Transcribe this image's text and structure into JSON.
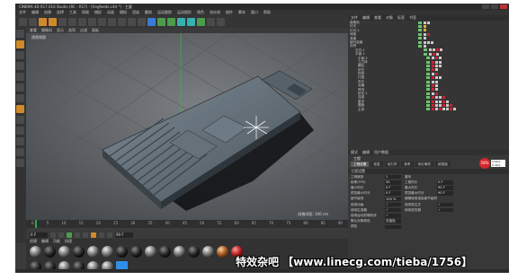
{
  "window": {
    "title": "CINEMA 4D R17.016 Studio (RC - R17) - [tingfeeds.c4d *] - 主要"
  },
  "menubar": {
    "items": [
      "文件",
      "编辑",
      "创建",
      "选择",
      "工具",
      "网格",
      "捕捉",
      "动画",
      "模拟",
      "渲染",
      "雕刻",
      "运动跟踪",
      "运动图形",
      "角色",
      "流水线",
      "插件",
      "脚本",
      "窗口",
      "帮助"
    ]
  },
  "viewport": {
    "menu": [
      "查看",
      "摄像机",
      "显示",
      "选项",
      "过滤",
      "面板"
    ],
    "label": "透视视图",
    "status": "网格间距: 100 cm"
  },
  "timeline": {
    "ticks": [
      "0",
      "5",
      "10",
      "15",
      "20",
      "25",
      "30",
      "35",
      "40",
      "45",
      "50",
      "55",
      "60",
      "65",
      "70",
      "75",
      "80",
      "85",
      "90"
    ],
    "frame_start": "0 F",
    "frame_end": "90 F"
  },
  "materials": {
    "menu": [
      "创建",
      "编辑",
      "功能",
      "纹理"
    ],
    "count": 22
  },
  "object_manager": {
    "tabs": [
      "文件",
      "编辑",
      "查看",
      "对象",
      "标签",
      "书签"
    ],
    "rows": [
      {
        "name": "摄像机",
        "tags": [
          "w",
          "w"
        ]
      },
      {
        "name": "灯光",
        "tags": [
          "y"
        ]
      },
      {
        "name": "灯光.1",
        "tags": [
          "y"
        ]
      },
      {
        "name": "地板",
        "tags": [
          "w",
          "r"
        ]
      },
      {
        "name": "背景",
        "tags": [
          "w"
        ]
      },
      {
        "name": "细分曲面",
        "tags": [
          "w",
          "w",
          "w"
        ]
      },
      {
        "name": "对称",
        "tags": [
          "w"
        ]
      },
      {
        "name": "空白.1",
        "tags": [
          "w",
          "w",
          "r",
          "w"
        ]
      },
      {
        "name": "平面.1",
        "tags": [
          "w",
          "r",
          "w"
        ]
      },
      {
        "name": "平面.2",
        "tags": [
          "w",
          "r",
          "w"
        ]
      },
      {
        "name": "立方体",
        "tags": [
          "r",
          "w",
          "w"
        ]
      },
      {
        "name": "圆柱",
        "tags": [
          "r",
          "w",
          "w"
        ]
      },
      {
        "name": "挤压",
        "tags": [
          "r",
          "w"
        ]
      },
      {
        "name": "样条",
        "tags": [
          "w",
          "r"
        ]
      },
      {
        "name": "扫描",
        "tags": [
          "r",
          "w",
          "w"
        ]
      },
      {
        "name": "布尔",
        "tags": [
          "w",
          "w"
        ]
      },
      {
        "name": "克隆",
        "tags": [
          "r",
          "w"
        ]
      },
      {
        "name": "阵列",
        "tags": [
          "r",
          "w"
        ]
      },
      {
        "name": "挤压.1",
        "tags": [
          "w",
          "r"
        ]
      },
      {
        "name": "连接",
        "tags": [
          "r",
          "w",
          "w",
          "r"
        ]
      },
      {
        "name": "星形",
        "tags": [
          "r",
          "w",
          "w",
          "r",
          "w"
        ]
      },
      {
        "name": "圆盘",
        "tags": [
          "r",
          "w",
          "w",
          "r",
          "w",
          "r"
        ]
      },
      {
        "name": "主体",
        "tags": [
          "r",
          "w",
          "r",
          "w",
          "w",
          "r",
          "w"
        ]
      }
    ]
  },
  "attribute_manager": {
    "menu": [
      "模式",
      "编辑",
      "用户数据"
    ],
    "title": "工程",
    "tabs": [
      "工程设置",
      "信息",
      "动力学",
      "参考",
      "待办事项",
      "帧插值"
    ],
    "section": "工程设置",
    "rows": [
      {
        "label": "工程缩放",
        "value": "1",
        "label2": "厘米",
        "value2": ""
      },
      {
        "label": "帧率(FPS)",
        "value": "30",
        "label2": "工程时长",
        "value2": "0 F"
      },
      {
        "label": "最小时长",
        "value": "0 F",
        "label2": "最大时长",
        "value2": "90 F"
      },
      {
        "label": "预览最小时长",
        "value": "0 F",
        "label2": "预览最大时长",
        "value2": "90 F"
      },
      {
        "label": "细节级别",
        "value": "100 %",
        "label2": "编辑使用渲染细节级别",
        "value2": ""
      },
      {
        "label": "使用动画",
        "value": "✓",
        "label2": "使用表达式",
        "value2": "✓"
      },
      {
        "label": "使用生成器",
        "value": "✓",
        "label2": "使用变形器",
        "value2": "✓"
      },
      {
        "label": "使用运动剪辑系统",
        "value": "✓",
        "label2": "",
        "value2": ""
      },
      {
        "label": "默认对象颜色",
        "value": "灰蓝色",
        "label2": "",
        "value2": ""
      },
      {
        "label": "颜色",
        "value": "",
        "label2": "",
        "value2": ""
      }
    ]
  },
  "badge": {
    "text": "58%",
    "note": "0.6K/s 0.4K/s"
  },
  "watermark": "特效杂吧 【www.linecg.com/tieba/1756】"
}
